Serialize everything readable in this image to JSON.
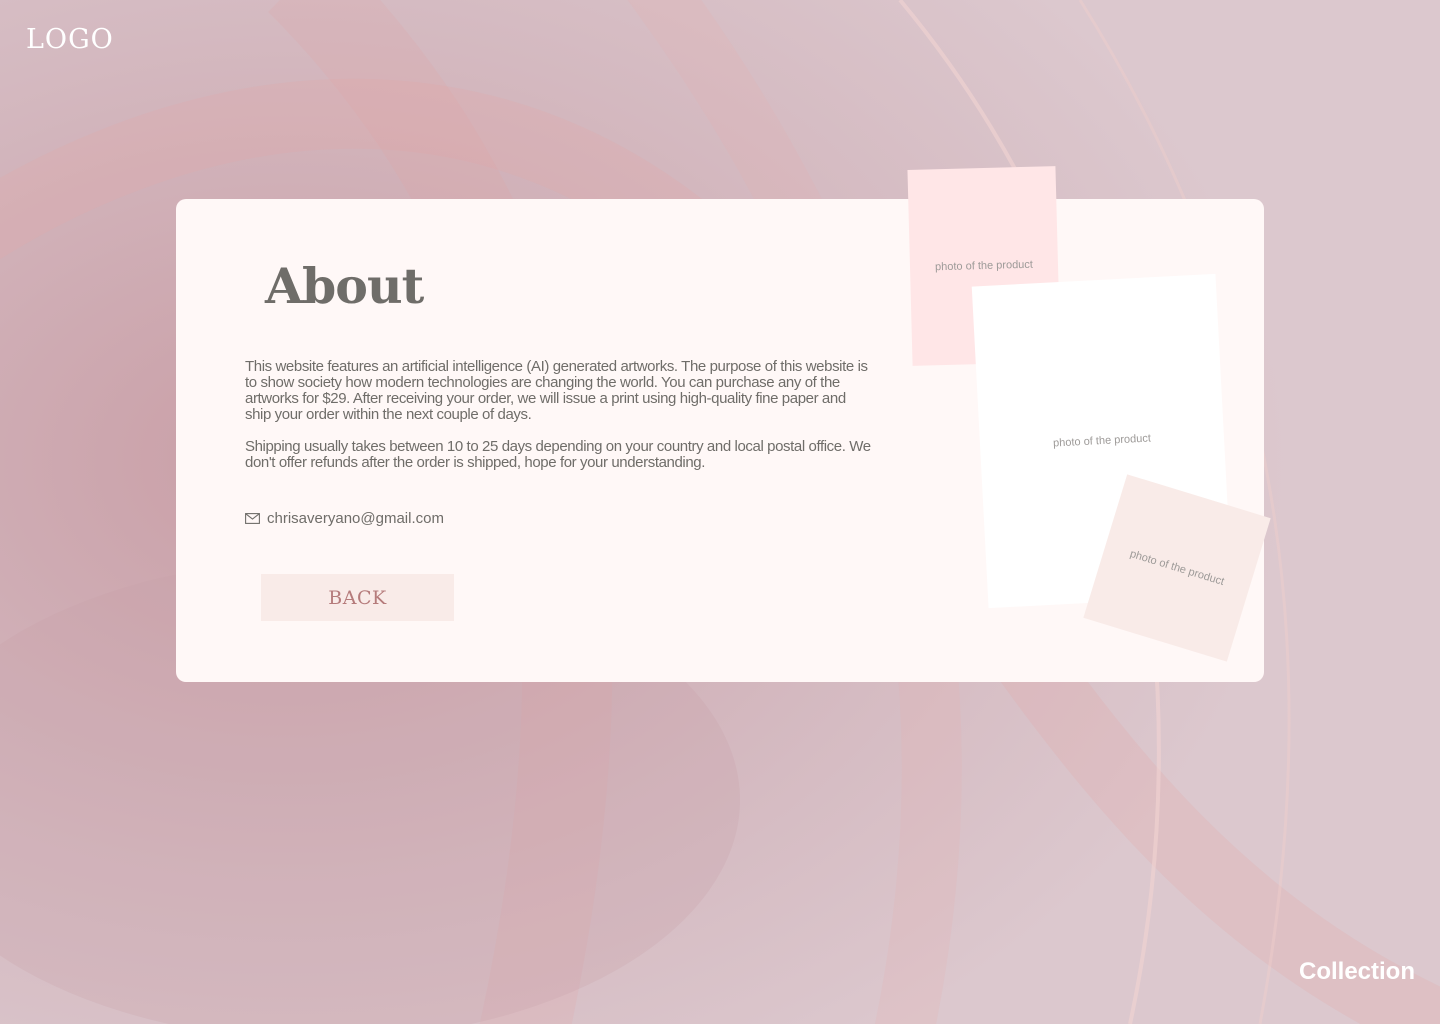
{
  "header": {
    "logo_text": "LOGO"
  },
  "nav": {
    "collection_label": "Collection"
  },
  "about": {
    "title": "About",
    "paragraph_1": "This website features an artificial intelligence (AI) generated artworks. The purpose of this website is to show society how modern technologies are changing the world. You can purchase any of the artworks for $29. After receiving your order, we will issue a print using high-quality fine paper and ship your order within the next couple of days.",
    "paragraph_2": "Shipping usually takes between 10 to 25 days depending on your country and local postal office. We don't offer refunds after the order is shipped, hope for your understanding.",
    "email": "chrisaveryano@gmail.com",
    "email_icon": "mail-icon",
    "back_label": "BACK"
  },
  "photos": [
    {
      "label": "photo of the product"
    },
    {
      "label": "photo of the product"
    },
    {
      "label": "photo of the product"
    }
  ],
  "colors": {
    "background": "#d9c3c9",
    "card": "#fff8f7",
    "text": "#6f6d69",
    "accent": "#b57b7b",
    "button_bg": "#f9ebe8",
    "photo_pink": "#ffe6e7"
  }
}
